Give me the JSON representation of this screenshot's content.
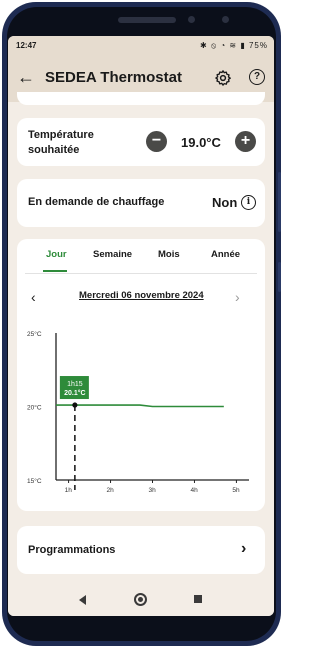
{
  "status_bar": {
    "time": "12:47",
    "icons_text": "✱ ⦸ ◔ ≋ ▮ 75%"
  },
  "app_bar": {
    "title": "SEDEA Thermostat"
  },
  "temperature": {
    "label": "Température souhaitée",
    "value": "19.0°C",
    "minus": "−",
    "plus": "+"
  },
  "heating_demand": {
    "label": "En demande de chauffage",
    "value": "Non",
    "info": "i"
  },
  "history": {
    "tabs": [
      {
        "label": "Jour",
        "active": true
      },
      {
        "label": "Semaine",
        "active": false
      },
      {
        "label": "Mois",
        "active": false
      },
      {
        "label": "Année",
        "active": false
      }
    ],
    "date": "Mercredi 06 novembre 2024",
    "prev": "‹",
    "next": "›"
  },
  "chart_data": {
    "type": "line",
    "title": "",
    "xlabel": "",
    "ylabel": "",
    "x_ticks": [
      "1h",
      "2h",
      "3h",
      "4h",
      "5h"
    ],
    "y_ticks": [
      "25°C",
      "20°C",
      "15°C"
    ],
    "xlim": [
      0.7,
      5.3
    ],
    "ylim": [
      15,
      25
    ],
    "series": [
      {
        "color": "#2e8b3a",
        "x": [
          0.7,
          2.7,
          3.0,
          4.7
        ],
        "y": [
          20.1,
          20.1,
          20.0,
          20.0
        ]
      }
    ],
    "tooltip": {
      "time": "1h15",
      "value": "20.1°C",
      "x": 1.15,
      "y": 20.1
    },
    "grid": false,
    "legend": "none"
  },
  "programmations": {
    "label": "Programmations",
    "chevron": "›"
  },
  "colors": {
    "accent": "#2e8b3a",
    "header": "#e6dccf",
    "background": "#f3ede6"
  }
}
